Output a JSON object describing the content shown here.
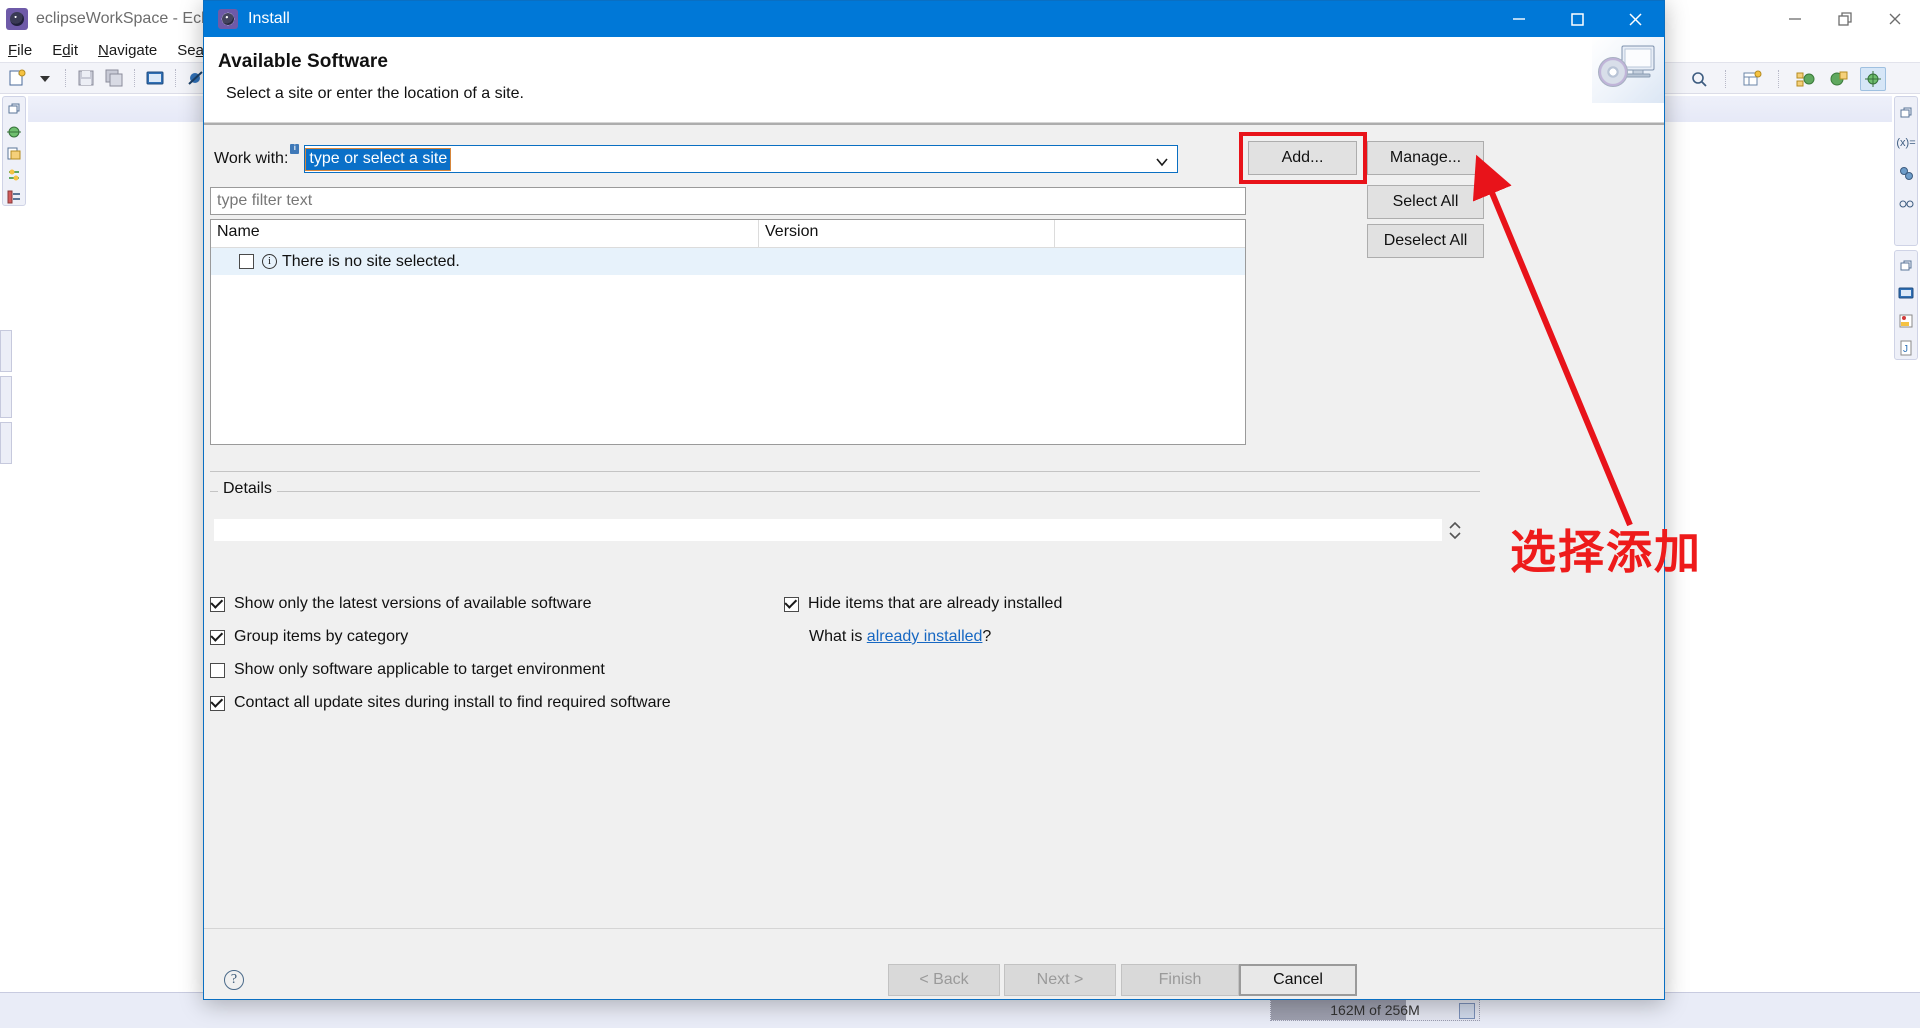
{
  "eclipse": {
    "title": "eclipseWorkSpace - Eclipse",
    "icon": "eclipse-icon",
    "menus": [
      "File",
      "Edit",
      "Navigate",
      "Search"
    ],
    "window_controls": {
      "minimize": "minimize-icon",
      "restore": "restore-icon",
      "close": "close-icon"
    },
    "status": {
      "heap": "162M of 256M",
      "trash": "trash-icon"
    }
  },
  "dialog": {
    "title": "Install",
    "icon": "install-icon",
    "window_controls": {
      "minimize": "minimize-icon",
      "maximize": "maximize-icon",
      "close": "close-icon"
    },
    "heading": "Available Software",
    "subheading": "Select a site or enter the location of a site.",
    "banner_icon": "monitor-cd-icon",
    "work_with": {
      "label": "Work with:",
      "info_badge": "i",
      "value": "type or select a site",
      "placeholder": "type or select a site",
      "dropdown_icon": "chevron-down-icon"
    },
    "buttons": {
      "add": "Add...",
      "manage": "Manage...",
      "select_all": "Select All",
      "deselect_all": "Deselect All"
    },
    "filter": {
      "value": "",
      "placeholder": "type filter text"
    },
    "table": {
      "columns": [
        "Name",
        "Version",
        ""
      ],
      "rows": [
        {
          "checked": false,
          "icon": "info-icon",
          "name": "There is no site selected.",
          "version": ""
        }
      ]
    },
    "details": {
      "legend": "Details",
      "value": "",
      "spinner_icon": "spinner-up-down-icon"
    },
    "options_left": [
      {
        "label": "Show only the latest versions of available software",
        "checked": true
      },
      {
        "label": "Group items by category",
        "checked": true
      },
      {
        "label": "Show only software applicable to target environment",
        "checked": false
      },
      {
        "label": "Contact all update sites during install to find required software",
        "checked": true
      }
    ],
    "options_right": [
      {
        "label": "Hide items that are already installed",
        "checked": true
      }
    ],
    "what_is": {
      "prefix": "What is ",
      "link": "already installed",
      "suffix": "?"
    },
    "footer": {
      "help_icon": "?",
      "back": "< Back",
      "next": "Next >",
      "finish": "Finish",
      "cancel": "Cancel"
    }
  },
  "annotation": {
    "text": "选择添加",
    "color": "#ee1b1b",
    "arrow": "points-to-add-button"
  },
  "colors": {
    "title_blue": "#0078d7",
    "dialog_bg": "#f0f0f0",
    "highlight_red": "#e8131a",
    "row_highlight": "#e7f2fb",
    "link_blue": "#1667c2",
    "selection_blue": "#0a70c8"
  }
}
